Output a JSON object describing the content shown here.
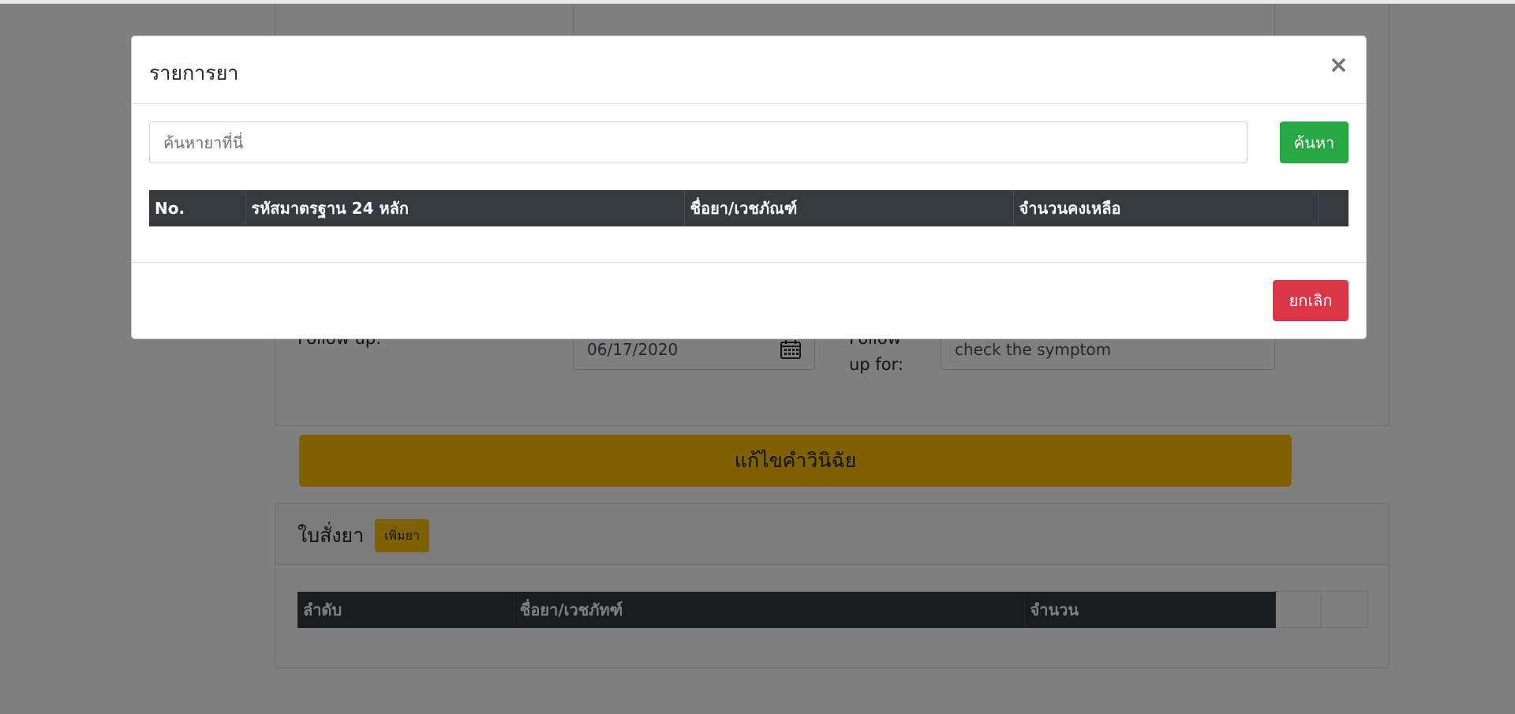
{
  "modal": {
    "title": "รายการยา",
    "close_symbol": "×",
    "search_placeholder": "ค้นหายาที่นี่",
    "search_button": "ค้นหา",
    "table_headers": [
      "No.",
      "รหัสมาตรฐาน 24 หลัก",
      "ชื่อยา/เวชภัณฑ์",
      "จำนวนคงเหลือ",
      ""
    ],
    "cancel_button": "ยกเลิก",
    "colors": {
      "search_button": "#28a745",
      "cancel_button": "#dc3545",
      "table_header": "#343a40"
    }
  },
  "background": {
    "follow_up_label": "Follow up:",
    "follow_up_date": "06/17/2020",
    "follow_up_for_label_line1": "Follow",
    "follow_up_for_label_line2": "up for:",
    "follow_up_for_value": "check the symptom",
    "edit_diagnosis_button": "แก้ไขคำวินิฉัย",
    "prescription_title": "ใบสั่งยา",
    "add_drug_button": "เพิ่มยา",
    "prescription_headers": [
      "ลำดับ",
      "ชื่อยา/เวชภัทฑ์",
      "จำนวน",
      "",
      ""
    ],
    "colors": {
      "warning": "#ffc107"
    }
  },
  "icons": {
    "date_picker": "calendar-icon",
    "close": "close-icon"
  }
}
